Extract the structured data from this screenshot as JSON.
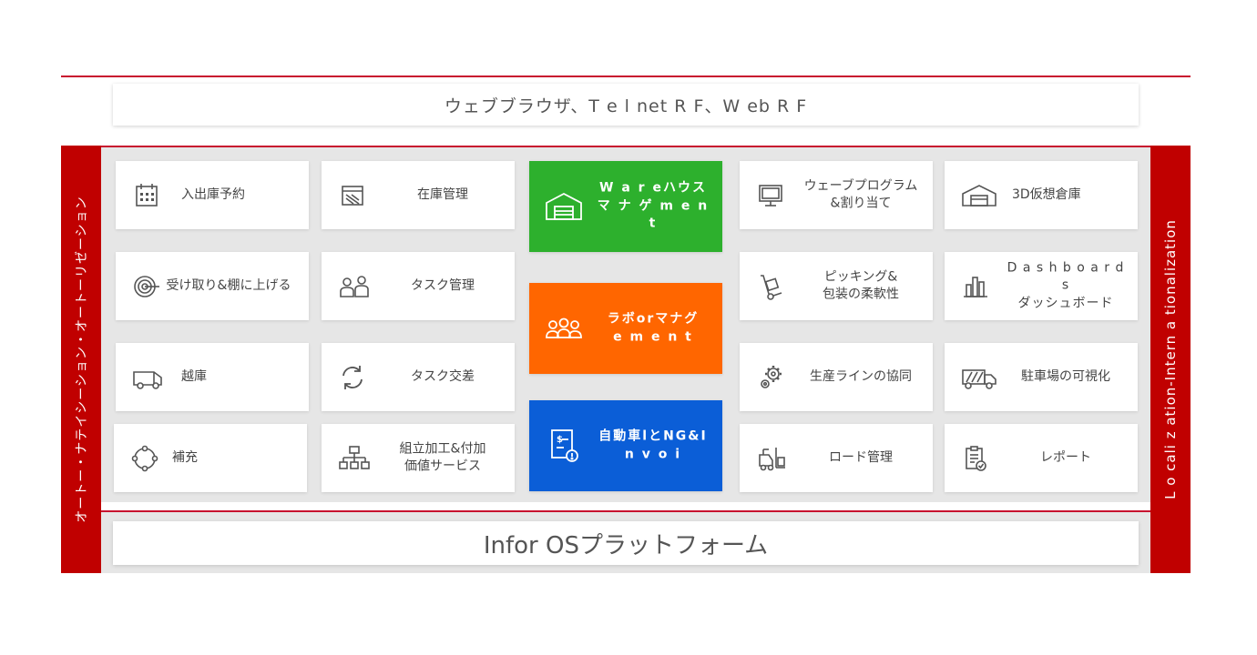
{
  "top_bar": {
    "label": "ウェブブラウザ、T e l net R F、W eb R F"
  },
  "left_side": {
    "label": "オートー・ナテイシーション・オートーリゼーション"
  },
  "right_side": {
    "label": "L o cali z ation-Intern a tionalization"
  },
  "platform": {
    "label": "Infor OSプラットフォーム"
  },
  "tiles": {
    "t1": {
      "label": "入出庫予約",
      "icon": "calendar-icon"
    },
    "t2": {
      "label": "在庫管理",
      "icon": "inventory-box-icon"
    },
    "t3": {
      "label": "W a r eハウス\nマ ナ ゲ m e n t",
      "icon": "warehouse-icon"
    },
    "t4": {
      "label": "ウェーブプログラム\n&割り当て",
      "icon": "monitor-icon"
    },
    "t5": {
      "label": "3D仮想倉庫",
      "icon": "virtual-warehouse-icon"
    },
    "t6": {
      "label": "受け取り&棚に上げる",
      "icon": "target-icon"
    },
    "t7": {
      "label": "タスク管理",
      "icon": "people-task-icon"
    },
    "t8": {
      "label": "ラボorマナグ\ne m e n t",
      "icon": "labor-people-icon"
    },
    "t9": {
      "label": "ピッキング&\n包装の柔軟性",
      "icon": "hand-truck-icon"
    },
    "t10": {
      "label": "D a s h b o a r d s\nダッシュボード",
      "icon": "bar-chart-icon"
    },
    "t11": {
      "label": "越庫",
      "icon": "van-icon"
    },
    "t12": {
      "label": "タスク交差",
      "icon": "refresh-icon"
    },
    "t13": {
      "label": "自動車lとNG&I\nn v o i",
      "icon": "invoice-icon"
    },
    "t14": {
      "label": "生産ラインの協同",
      "icon": "gears-icon"
    },
    "t15": {
      "label": "駐車場の可視化",
      "icon": "truck-icon"
    },
    "t16": {
      "label": "補充",
      "icon": "cycle-icon"
    },
    "t17": {
      "label": "組立加工&付加\n価値サービス",
      "icon": "hierarchy-icon"
    },
    "t18": {
      "label": "ロード管理",
      "icon": "forklift-icon"
    },
    "t19": {
      "label": "レポート",
      "icon": "clipboard-check-icon"
    }
  },
  "colors": {
    "accent_red": "#c00000",
    "warehouse_green": "#2db02d",
    "labor_orange": "#ff6600",
    "billing_blue": "#0b5ed7"
  }
}
